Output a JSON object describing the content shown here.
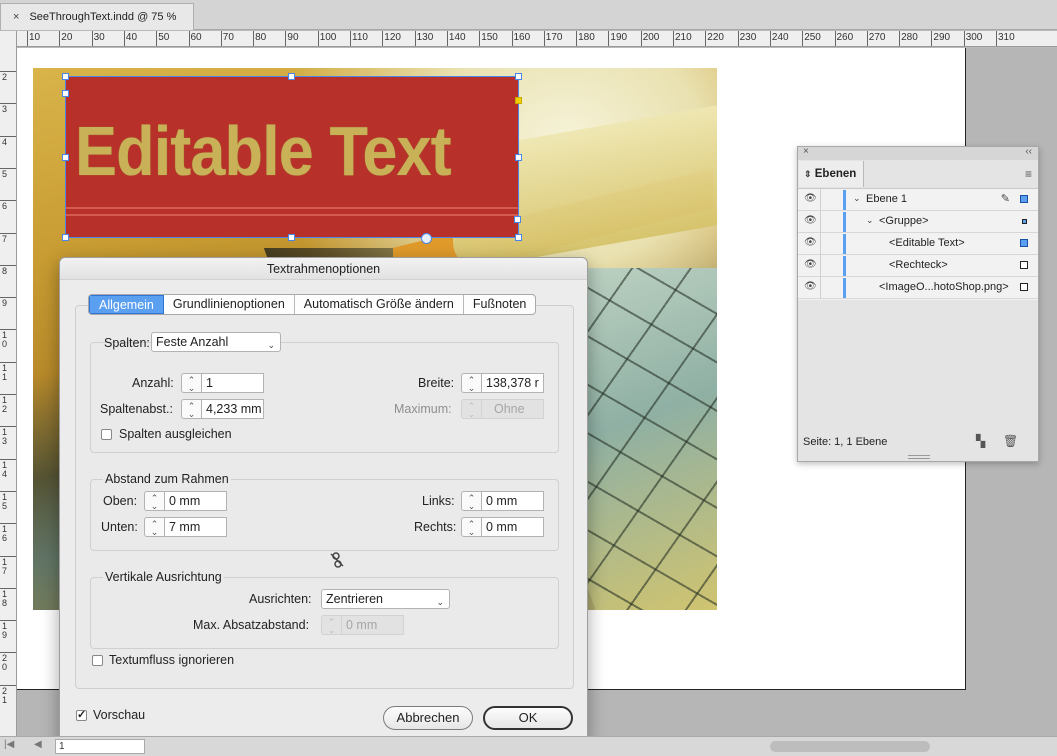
{
  "document_tab": {
    "close": "×",
    "title": "SeeThroughText.indd @ 75 %"
  },
  "ruler": {
    "top_labels": [
      "10",
      "20",
      "30",
      "40",
      "50",
      "60",
      "70",
      "80",
      "90",
      "100",
      "110",
      "120",
      "130",
      "140",
      "150",
      "160",
      "170",
      "180",
      "190",
      "200",
      "210",
      "220",
      "230",
      "240",
      "250",
      "260",
      "270",
      "280",
      "290",
      "300",
      "310"
    ],
    "left_labels": [
      "2",
      "3",
      "4",
      "5",
      "6",
      "7",
      "8",
      "9",
      "10",
      "11",
      "12",
      "13",
      "14",
      "15",
      "16",
      "17",
      "18",
      "19",
      "20",
      "21"
    ]
  },
  "canvas": {
    "frame_text": "Editable Text"
  },
  "dialog": {
    "title": "Textrahmenoptionen",
    "tabs": [
      "Allgemein",
      "Grundlinienoptionen",
      "Automatisch Größe ändern",
      "Fußnoten"
    ],
    "columns": {
      "label": "Spalten:",
      "type_value": "Feste Anzahl",
      "count_label": "Anzahl:",
      "count_value": "1",
      "gutter_label": "Spaltenabst.:",
      "gutter_value": "4,233 mm",
      "width_label": "Breite:",
      "width_value": "138,378 r",
      "max_label": "Maximum:",
      "max_value": "Ohne",
      "balance_label": "Spalten ausgleichen"
    },
    "inset": {
      "title": "Abstand zum Rahmen",
      "top_label": "Oben:",
      "top_value": "0 mm",
      "bottom_label": "Unten:",
      "bottom_value": "7 mm",
      "left_label": "Links:",
      "left_value": "0 mm",
      "right_label": "Rechts:",
      "right_value": "0 mm"
    },
    "vertical": {
      "title": "Vertikale Ausrichtung",
      "align_label": "Ausrichten:",
      "align_value": "Zentrieren",
      "max_label": "Max. Absatzabstand:",
      "max_value": "0 mm"
    },
    "ignore_wrap_label": "Textumfluss ignorieren",
    "preview_label": "Vorschau",
    "cancel_label": "Abbrechen",
    "ok_label": "OK"
  },
  "layers_panel": {
    "close": "×",
    "collapse": "‹‹",
    "tab": "Ebenen",
    "rows": [
      {
        "name": "Ebene 1"
      },
      {
        "name": "<Gruppe>"
      },
      {
        "name": "<Editable Text>"
      },
      {
        "name": "<Rechteck>"
      },
      {
        "name": "<ImageO...hotoShop.png>"
      }
    ],
    "footer": "Seite: 1, 1 Ebene"
  },
  "statusbar": {
    "page": "1"
  },
  "colors": {
    "accent": "#5b9ff0",
    "frame_red": "#b7312a",
    "text_gold": "#c8b156"
  }
}
